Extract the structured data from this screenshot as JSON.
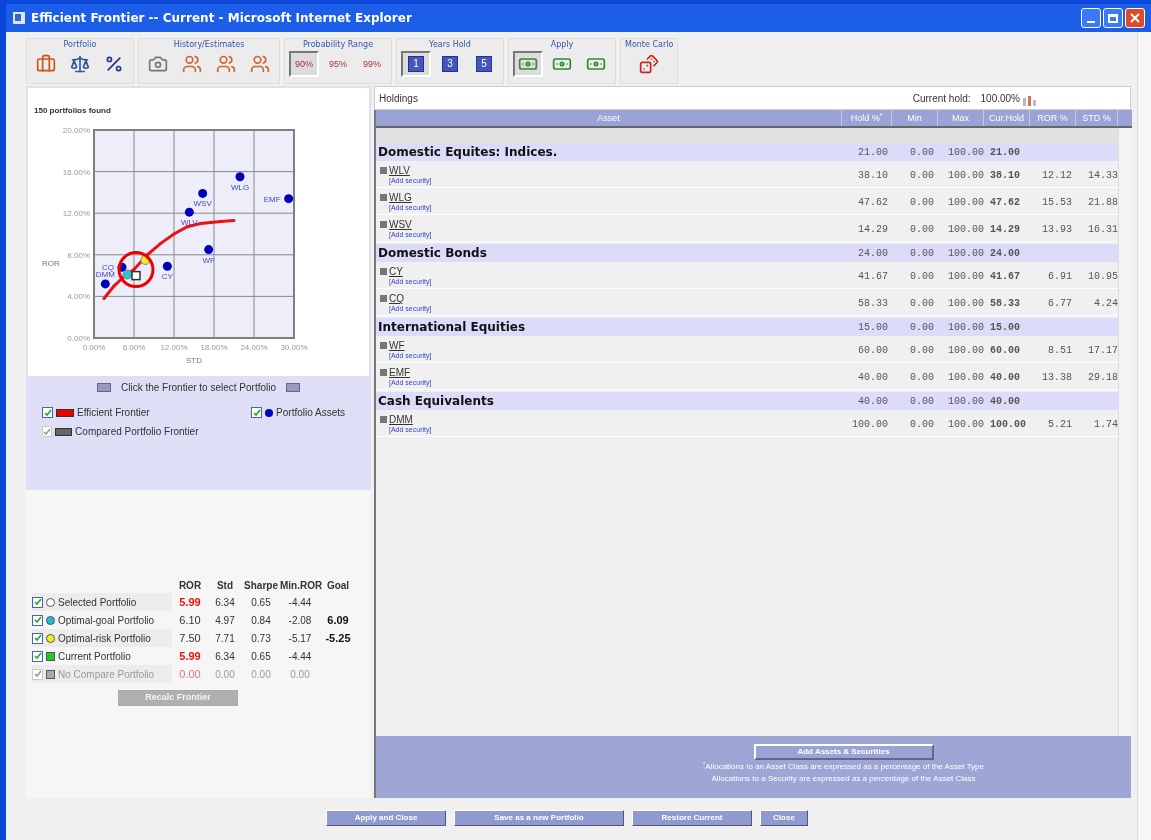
{
  "window": {
    "title": "Efficient Frontier -- Current - Microsoft Internet Explorer"
  },
  "toolbar": [
    {
      "kind": "portfolio",
      "label": "Portfolio",
      "buttons": [
        {
          "selected": false
        },
        {
          "selected": false
        },
        {
          "selected": false
        }
      ]
    },
    {
      "kind": "history",
      "label": "History/Estimates",
      "buttons": [
        {
          "selected": false
        },
        {
          "selected": false
        },
        {
          "selected": false
        },
        {
          "selected": false
        }
      ]
    },
    {
      "kind": "probability",
      "label": "Probability Range",
      "buttons": [
        {
          "label": "90%",
          "selected": true
        },
        {
          "label": "95%",
          "selected": false
        },
        {
          "label": "99%",
          "selected": false
        }
      ]
    },
    {
      "kind": "years",
      "label": "Years Hold",
      "buttons": [
        {
          "label": "1",
          "selected": true
        },
        {
          "label": "3",
          "selected": false
        },
        {
          "label": "5",
          "selected": false
        }
      ]
    },
    {
      "kind": "apply",
      "label": "Apply",
      "buttons": [
        {
          "selected": true
        },
        {
          "selected": false
        },
        {
          "selected": false
        }
      ]
    },
    {
      "kind": "montecarlo",
      "label": "Monte Carlo",
      "buttons": [
        {
          "selected": false
        }
      ]
    }
  ],
  "chart_panel": {
    "status": "150 portfolios found",
    "chart_data": {
      "type": "scatter",
      "xlabel": "STD",
      "ylabel": "ROR",
      "xlim": [
        0,
        30
      ],
      "ylim": [
        0,
        20
      ],
      "grid": true,
      "xticks": [
        {
          "value": 0,
          "label": "0.00%"
        },
        {
          "value": 6,
          "label": "6.00%"
        },
        {
          "value": 12,
          "label": "12.00%"
        },
        {
          "value": 18,
          "label": "18.00%"
        },
        {
          "value": 24,
          "label": "24.00%"
        },
        {
          "value": 30,
          "label": "30.00%"
        }
      ],
      "yticks": [
        {
          "value": 0,
          "label": "0.00%"
        },
        {
          "value": 4,
          "label": "4.00%"
        },
        {
          "value": 8,
          "label": "8.00%"
        },
        {
          "value": 12,
          "label": "12.00%"
        },
        {
          "value": 16,
          "label": "16.00%"
        },
        {
          "value": 20,
          "label": "20.00%"
        }
      ],
      "series": [
        {
          "type": "line",
          "color": "#ee1111",
          "x": [
            1.5,
            3,
            4.5,
            6,
            8,
            10,
            12,
            14,
            16,
            19,
            21
          ],
          "values": [
            3.8,
            5,
            5.9,
            6.6,
            8,
            9.1,
            10,
            10.7,
            11,
            11.2,
            11.3
          ]
        },
        {
          "color": "#0000bb",
          "x": [
            1.7,
            4.2,
            11,
            14.3,
            16.3,
            17.2,
            21.9,
            29.2
          ],
          "values": [
            5.2,
            6.8,
            6.9,
            12.1,
            13.9,
            8.5,
            15.5,
            13.4
          ]
        },
        {
          "color": "#22cccc",
          "x": [
            5
          ],
          "values": [
            6.1
          ]
        },
        {
          "color": "#ffffff",
          "x": [
            6.3
          ],
          "values": [
            6
          ]
        },
        {
          "color": "#eeee22",
          "x": [
            7.7
          ],
          "values": [
            7.5
          ]
        }
      ],
      "annotations": [
        {
          "x": 1.7,
          "y": 5.2,
          "text": "DMM"
        },
        {
          "x": 4.2,
          "y": 6.8,
          "text": "CQ"
        },
        {
          "x": 11,
          "y": 6.9,
          "text": "CY"
        },
        {
          "x": 14.3,
          "y": 12.1,
          "text": "WLV"
        },
        {
          "x": 16.3,
          "y": 13.9,
          "text": "WSV"
        },
        {
          "x": 17.2,
          "y": 8.5,
          "text": "WF"
        },
        {
          "x": 21.9,
          "y": 15.5,
          "text": "WLG"
        },
        {
          "x": 29.2,
          "y": 13.4,
          "text": "EMF"
        }
      ]
    },
    "hint": "Click the Frontier to select Portfolio",
    "legend": [
      {
        "label": "Efficient Frontier",
        "kind": "bar",
        "color": "#ee0000",
        "checked": true,
        "disabled": false
      },
      {
        "label": "Portfolio Assets",
        "kind": "dot",
        "color": "#0000bb",
        "checked": true,
        "disabled": false
      },
      {
        "label": "Compared Portfolio Frontier",
        "kind": "bar",
        "color": "#666666",
        "checked": true,
        "disabled": true
      }
    ]
  },
  "stats": {
    "columns": [
      "ROR",
      "Std",
      "Sharpe",
      "Min.ROR",
      "Goal"
    ],
    "rows": [
      {
        "name": "Selected Portfolio",
        "kind": "ring",
        "color": "#ffffff",
        "checked": true,
        "disabled": false,
        "ror": "5.99",
        "ror_alert": true,
        "std": "6.34",
        "sharpe": "0.65",
        "min_ror": "-4.44"
      },
      {
        "name": "Optimal-goal Portfolio",
        "kind": "dot",
        "color": "#22bbdd",
        "checked": true,
        "disabled": false,
        "ror": "6.10",
        "ror_alert": false,
        "std": "4.97",
        "sharpe": "0.84",
        "min_ror": "-2.08",
        "goal": "6.09"
      },
      {
        "name": "Optimal-risk Portfolio",
        "kind": "dot",
        "color": "#eeee22",
        "checked": true,
        "disabled": false,
        "ror": "7.50",
        "ror_alert": false,
        "std": "7.71",
        "sharpe": "0.73",
        "min_ror": "-5.17",
        "goal": "-5.25"
      },
      {
        "name": "Current Portfolio",
        "kind": "square",
        "color": "#22cc22",
        "checked": true,
        "disabled": false,
        "ror": "5.99",
        "ror_alert": true,
        "std": "6.34",
        "sharpe": "0.65",
        "min_ror": "-4.44"
      },
      {
        "name": "No Compare Portfolio",
        "kind": "square",
        "color": "#aaaaaa",
        "checked": true,
        "disabled": true,
        "ror": "0.00",
        "ror_alert": true,
        "std": "0.00",
        "sharpe": "0.00",
        "min_ror": "0.00"
      }
    ],
    "button": {
      "label": "Recalc Frontier",
      "disabled": true
    }
  },
  "holdings": {
    "title": "Holdings",
    "current_hold_label": "Current hold:",
    "current_hold": "100.00%",
    "columns": [
      "Asset",
      "Hold %$^{*}$",
      "Min",
      "Max",
      "Cur.Hold",
      "ROR %",
      "STD %"
    ],
    "rows": [
      {
        "kind": "group",
        "name": "Domestic Equites: Indices.",
        "hold": "21.00",
        "min": "0.00",
        "max": "100.00",
        "cur": "21.00"
      },
      {
        "kind": "asset",
        "name": "WLV",
        "link": "[Add security]",
        "hold": "38.10",
        "min": "0.00",
        "max": "100.00",
        "cur": "38.10",
        "ror": "12.12",
        "std": "14.33"
      },
      {
        "kind": "asset",
        "name": "WLG",
        "link": "[Add security]",
        "hold": "47.62",
        "min": "0.00",
        "max": "100.00",
        "cur": "47.62",
        "ror": "15.53",
        "std": "21.88"
      },
      {
        "kind": "asset",
        "name": "WSV",
        "link": "[Add security]",
        "hold": "14.29",
        "min": "0.00",
        "max": "100.00",
        "cur": "14.29",
        "ror": "13.93",
        "std": "16.31"
      },
      {
        "kind": "group",
        "name": "Domestic Bonds",
        "hold": "24.00",
        "min": "0.00",
        "max": "100.00",
        "cur": "24.00"
      },
      {
        "kind": "asset",
        "name": "CY",
        "link": "[Add security]",
        "hold": "41.67",
        "min": "0.00",
        "max": "100.00",
        "cur": "41.67",
        "ror": "6.91",
        "std": "10.95"
      },
      {
        "kind": "asset",
        "name": "CQ",
        "link": "[Add security]",
        "hold": "58.33",
        "min": "0.00",
        "max": "100.00",
        "cur": "58.33",
        "ror": "6.77",
        "std": "4.24"
      },
      {
        "kind": "group",
        "name": "International Equities",
        "hold": "15.00",
        "min": "0.00",
        "max": "100.00",
        "cur": "15.00"
      },
      {
        "kind": "asset",
        "name": "WF",
        "link": "[Add security]",
        "hold": "60.00",
        "min": "0.00",
        "max": "100.00",
        "cur": "60.00",
        "ror": "8.51",
        "std": "17.17"
      },
      {
        "kind": "asset",
        "name": "EMF",
        "link": "[Add security]",
        "hold": "40.00",
        "min": "0.00",
        "max": "100.00",
        "cur": "40.00",
        "ror": "13.38",
        "std": "29.18"
      },
      {
        "kind": "group",
        "name": "Cash Equivalents",
        "hold": "40.00",
        "min": "0.00",
        "max": "100.00",
        "cur": "40.00"
      },
      {
        "kind": "asset",
        "name": "DMM",
        "link": "[Add security]",
        "hold": "100.00",
        "min": "0.00",
        "max": "100.00",
        "cur": "100.00",
        "ror": "5.21",
        "std": "1.74"
      }
    ],
    "add_button": "Add Assets & Securities",
    "notes": [
      "$^{*}$Allocations to an Asset Class are expressed as a percentage of the Asset Type",
      "Allocations to a Security are expressed as a percentage of the Asset Class"
    ]
  },
  "buttons": [
    "Apply and Close",
    "Save as a new Portfolio",
    "Restore Current",
    "Close"
  ]
}
